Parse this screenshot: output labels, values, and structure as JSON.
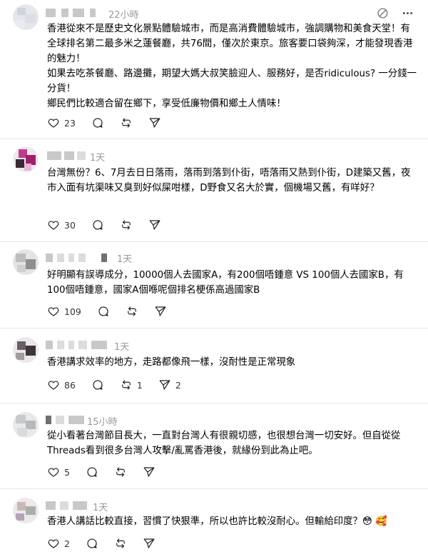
{
  "posts": [
    {
      "time": "22小時",
      "body": "香港從來不是歷史文化景點體驗城市，而是高消費體驗城市，強調購物和美食天堂！有全球排名第二最多米之蓮餐廳，共76間，僅次於東京。旅客要口袋夠深，才能發現香港的魅力！\n如果去吃茶餐廳、路邊攤，期望大媽大叔笑臉迎人、服務好，是否ridiculous? 一分錢一分貨！\n鄉民們比較適合留在鄉下，享受低廉物價和鄉土人情味！",
      "likes": "23",
      "comments": "",
      "reposts": "",
      "shares": ""
    },
    {
      "time": "1天",
      "body": "台灣無份？6、7月去日日落雨，落雨到落到仆街，唔落雨又熱到仆街，D建築又舊，夜市入面有坑渠味又臭到好似屎咁樣，D野食又名大於實，個機場又舊，有咩好？",
      "likes": "30",
      "comments": "",
      "reposts": "",
      "shares": ""
    },
    {
      "time": "1天",
      "body": "好明顯有誤導成分，10000個人去國家A，有200個唔鍾意 VS 100個人去國家B，有100個唔鍾意，國家A個喺呢個排名梗係高過國家B",
      "likes": "109",
      "comments": "",
      "reposts": "",
      "shares": ""
    },
    {
      "time": "1天",
      "body": "香港講求效率的地方，走路都像飛一樣，沒耐性是正常現象",
      "likes": "86",
      "comments": "",
      "reposts": "1",
      "shares": "2"
    },
    {
      "time": "15小時",
      "body": "從小看著台灣節目長大，一直對台灣人有很親切感，也很想台灣一切安好。但自從從Threads看到很多台灣人攻擊/亂罵香港後，就緣份到此為止吧。",
      "likes": "5",
      "comments": "",
      "reposts": "",
      "shares": ""
    },
    {
      "time": "1天",
      "body": "香港人講話比較直接，習慣了快狠準，所以也許比較沒耐心。但輸給印度？😳 🥰",
      "likes": "2",
      "comments": "",
      "reposts": "",
      "shares": ""
    }
  ],
  "icons": {
    "like": "heart-icon",
    "comment": "comment-icon",
    "repost": "repost-icon",
    "share": "share-icon",
    "top_a": "slash-circle-icon",
    "top_b": "more-icon"
  }
}
